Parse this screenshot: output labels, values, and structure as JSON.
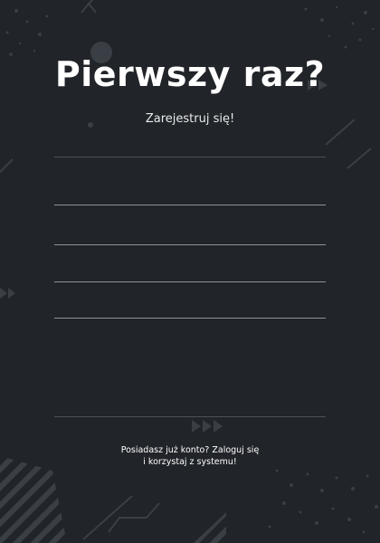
{
  "page": {
    "title": "Pierwszy raz?",
    "subtitle": "Zarejestruj się!"
  },
  "form": {
    "fields": [
      {
        "value": "",
        "placeholder": ""
      },
      {
        "value": "",
        "placeholder": ""
      },
      {
        "value": "",
        "placeholder": ""
      },
      {
        "value": "",
        "placeholder": ""
      },
      {
        "value": "",
        "placeholder": ""
      }
    ]
  },
  "footer": {
    "line1": "Posiadasz już konto? Zaloguj się",
    "line2": "i korzystaj z systemu!"
  },
  "colors": {
    "background": "#212428",
    "decoration": "#3a3f46",
    "line_light": "#8e939a",
    "line_dim": "#4d5259",
    "text": "#ffffff"
  }
}
